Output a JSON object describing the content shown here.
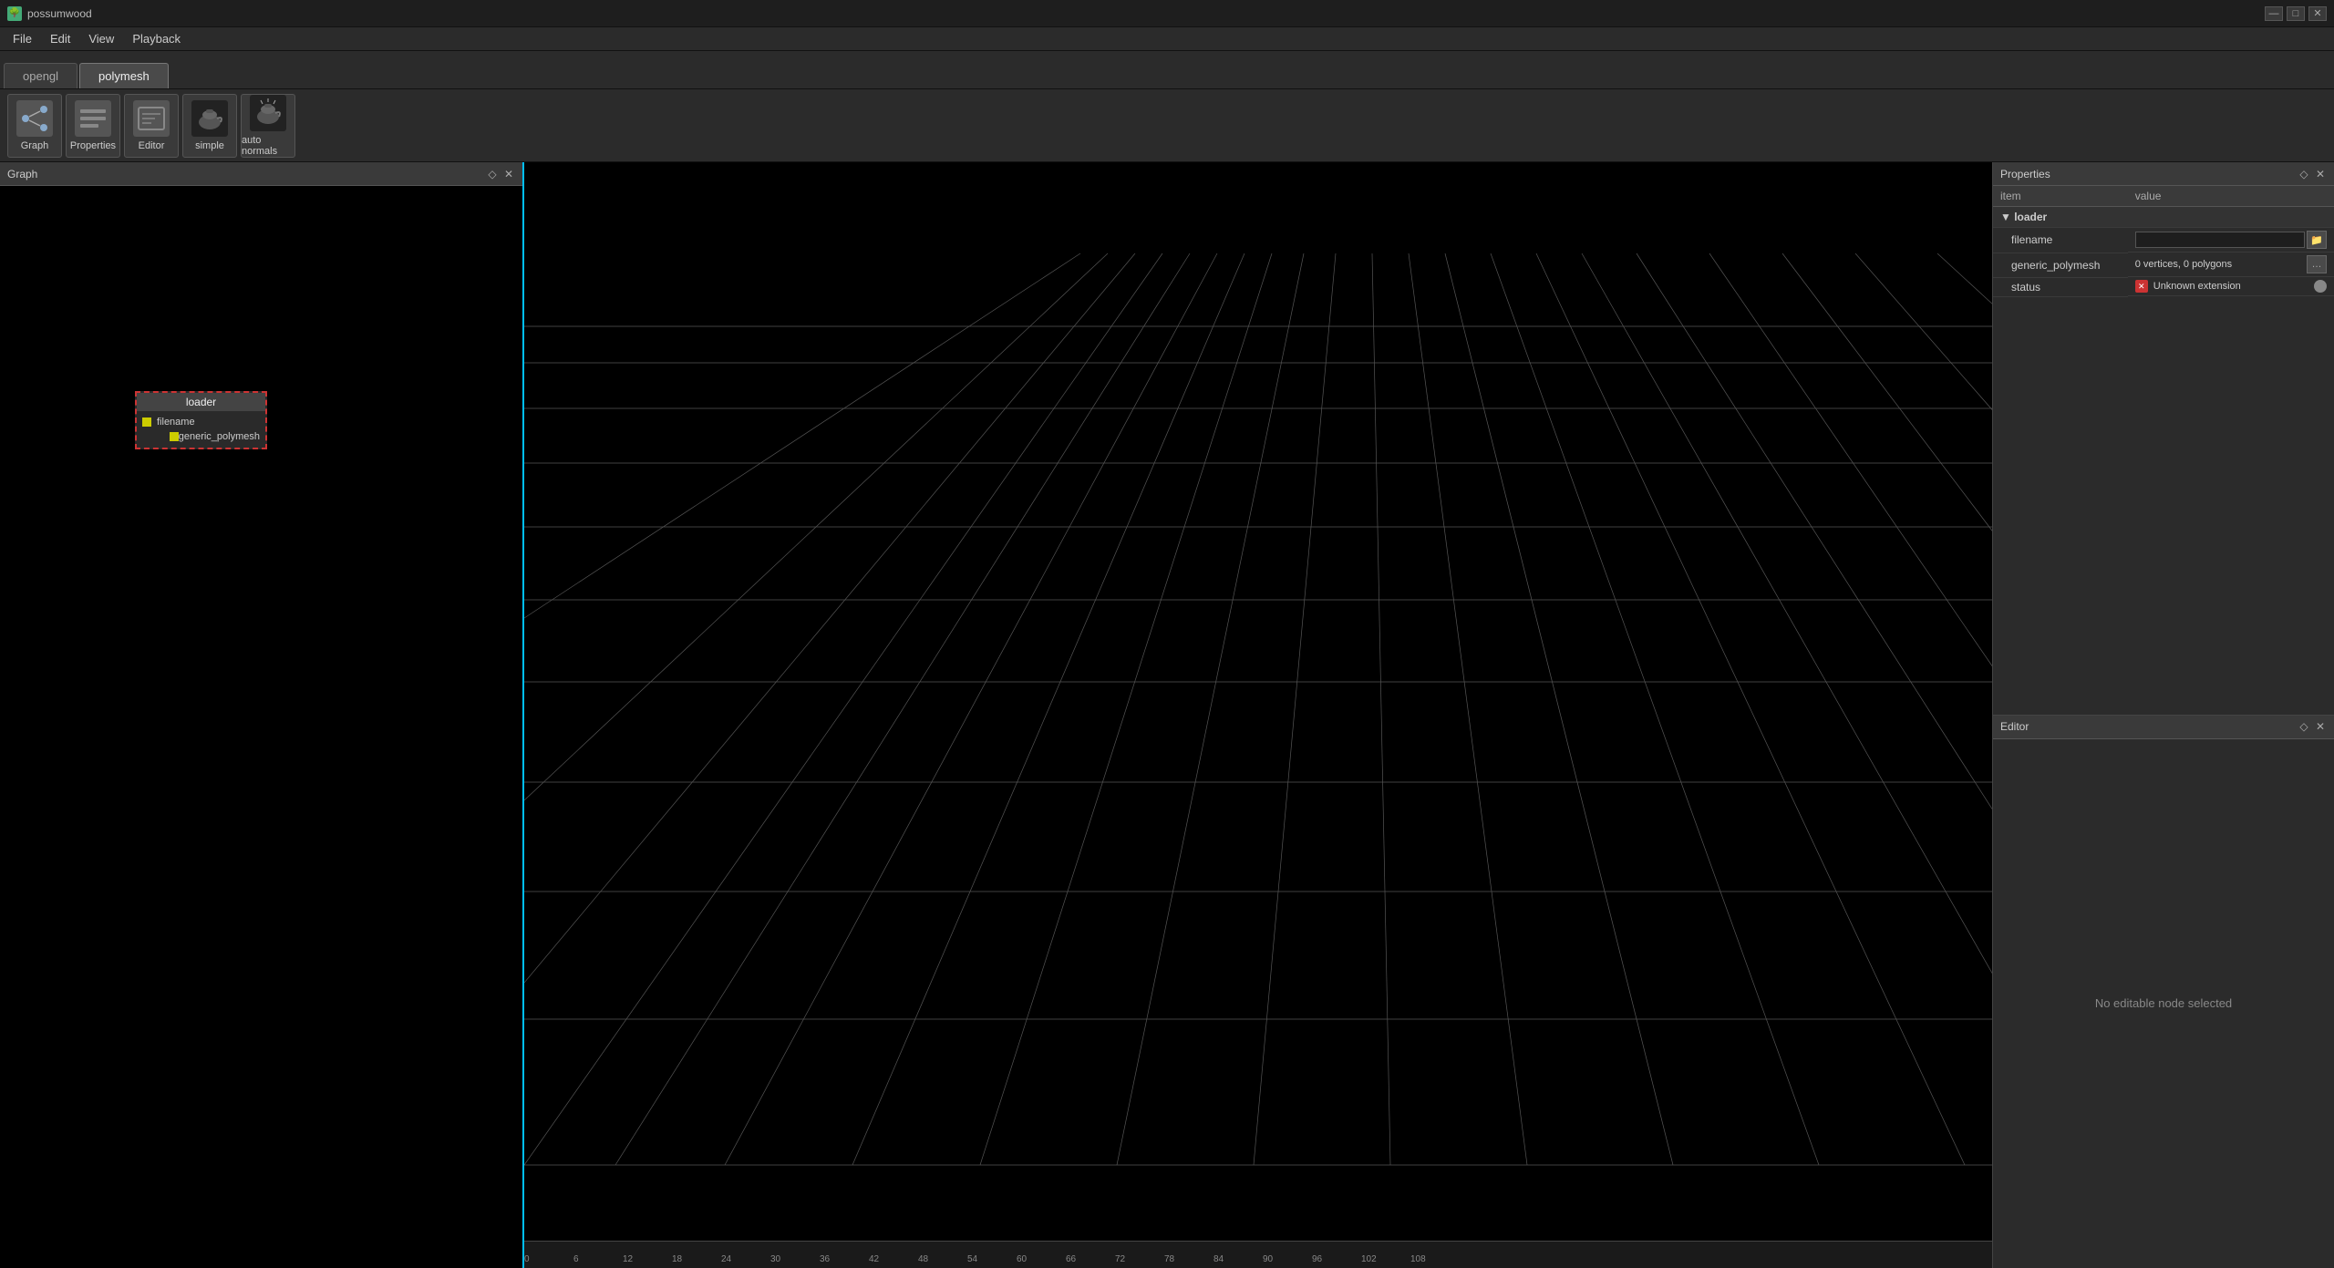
{
  "app": {
    "title": "possumwood",
    "icon": "🌳"
  },
  "window_controls": {
    "minimize": "—",
    "maximize": "□",
    "close": "✕"
  },
  "menubar": {
    "items": [
      "File",
      "Edit",
      "View",
      "Playback"
    ]
  },
  "tabs": [
    {
      "id": "opengl",
      "label": "opengl",
      "active": false
    },
    {
      "id": "polymesh",
      "label": "polymesh",
      "active": true
    }
  ],
  "toolbar": {
    "buttons": [
      {
        "id": "graph",
        "label": "Graph",
        "type": "graph"
      },
      {
        "id": "properties",
        "label": "Properties",
        "type": "properties"
      },
      {
        "id": "editor",
        "label": "Editor",
        "type": "editor"
      },
      {
        "id": "simple",
        "label": "simple",
        "type": "render"
      },
      {
        "id": "auto_normals",
        "label": "auto normals",
        "type": "render"
      }
    ]
  },
  "graph_panel": {
    "title": "Graph",
    "pin_icon": "◇",
    "close_icon": "✕"
  },
  "node": {
    "title": "loader",
    "ports": [
      {
        "type": "input",
        "name": "filename"
      },
      {
        "type": "output",
        "name": "generic_polymesh"
      }
    ]
  },
  "properties_panel": {
    "title": "Properties",
    "pin_icon": "◇",
    "close_icon": "✕",
    "columns": [
      "item",
      "value"
    ],
    "rows": [
      {
        "type": "section",
        "indent": false,
        "item": "loader",
        "value": "",
        "arrow": "▼"
      },
      {
        "type": "data",
        "indent": true,
        "item": "filename",
        "value": "",
        "input_type": "text_file"
      },
      {
        "type": "data",
        "indent": true,
        "item": "generic_polymesh",
        "value": "0 vertices, 0 polygons",
        "input_type": "readonly_more"
      },
      {
        "type": "data",
        "indent": true,
        "item": "status",
        "value": "Unknown extension",
        "input_type": "status"
      }
    ]
  },
  "editor_panel": {
    "title": "Editor",
    "pin_icon": "◇",
    "close_icon": "✕",
    "empty_message": "No editable node selected"
  },
  "timeline": {
    "ticks": [
      0,
      6,
      12,
      18,
      24,
      30,
      36,
      42,
      48,
      54,
      60,
      66,
      72,
      78,
      84,
      90,
      96,
      102,
      108
    ],
    "visible_ticks": [
      "0",
      "6",
      "12",
      "18",
      "24",
      "30",
      "36",
      "42",
      "48",
      "54",
      "60",
      "66",
      "72",
      "78",
      "84",
      "90",
      "96",
      "102",
      "108"
    ]
  }
}
